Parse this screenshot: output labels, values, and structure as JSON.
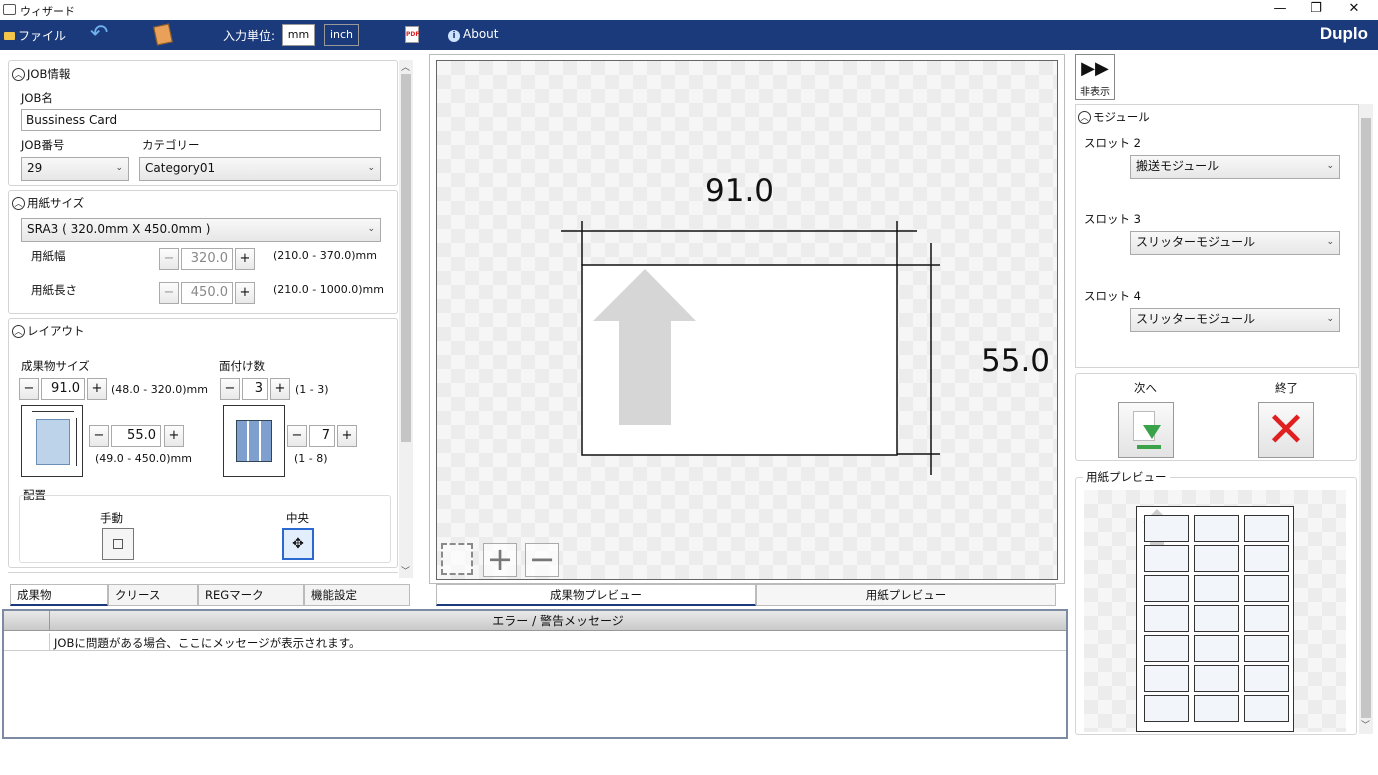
{
  "window": {
    "title": "ウィザード",
    "minimize": "—",
    "maximize": "❐",
    "close": "✕"
  },
  "menu": {
    "file": "ファイル",
    "unit_label": "入力単位:",
    "unit_mm": "mm",
    "unit_inch": "inch",
    "pdf_text": "PDF",
    "about": "About",
    "brand": "Duplo"
  },
  "job": {
    "section": "JOB情報",
    "name_label": "JOB名",
    "name_value": "Bussiness Card",
    "number_label": "JOB番号",
    "number_value": "29",
    "category_label": "カテゴリー",
    "category_value": "Category01"
  },
  "paper": {
    "section": "用紙サイズ",
    "size_value": "SRA3 ( 320.0mm X 450.0mm )",
    "width_label": "用紙幅",
    "width_value": "320.0",
    "width_range": "(210.0 - 370.0)mm",
    "length_label": "用紙長さ",
    "length_value": "450.0",
    "length_range": "(210.0 - 1000.0)mm"
  },
  "layout": {
    "section": "レイアウト",
    "product_size_label": "成果物サイズ",
    "product_width": "91.0",
    "product_width_range": "(48.0 - 320.0)mm",
    "product_height": "55.0",
    "product_height_range": "(49.0 - 450.0)mm",
    "imposition_label": "面付け数",
    "imposition_cols": "3",
    "imposition_cols_range": "(1 - 3)",
    "imposition_rows": "7",
    "imposition_rows_range": "(1 - 8)",
    "placement_label": "配置",
    "manual_label": "手動",
    "center_label": "中央"
  },
  "left_tabs": [
    "成果物",
    "クリース",
    "REGマーク",
    "機能設定"
  ],
  "preview": {
    "width_dim": "91.0",
    "height_dim": "55.0",
    "tabs": [
      "成果物プレビュー",
      "用紙プレビュー"
    ]
  },
  "right": {
    "hide_label": "非表示",
    "module_section": "モジュール",
    "slots": [
      {
        "label": "スロット 2",
        "value": "搬送モジュール"
      },
      {
        "label": "スロット 3",
        "value": "スリッターモジュール"
      },
      {
        "label": "スロット 4",
        "value": "スリッターモジュール"
      }
    ],
    "next_label": "次へ",
    "finish_label": "終了",
    "paper_preview_label": "用紙プレビュー"
  },
  "messages": {
    "header": "エラー / 警告メッセージ",
    "rows": [
      "JOBに問題がある場合、ここにメッセージが表示されます。"
    ]
  },
  "imposition_grid": {
    "cols": 3,
    "rows": 7
  },
  "colors": {
    "menubar": "#1b3a7c",
    "finish_red": "#e02020",
    "next_green": "#3aa34a"
  }
}
